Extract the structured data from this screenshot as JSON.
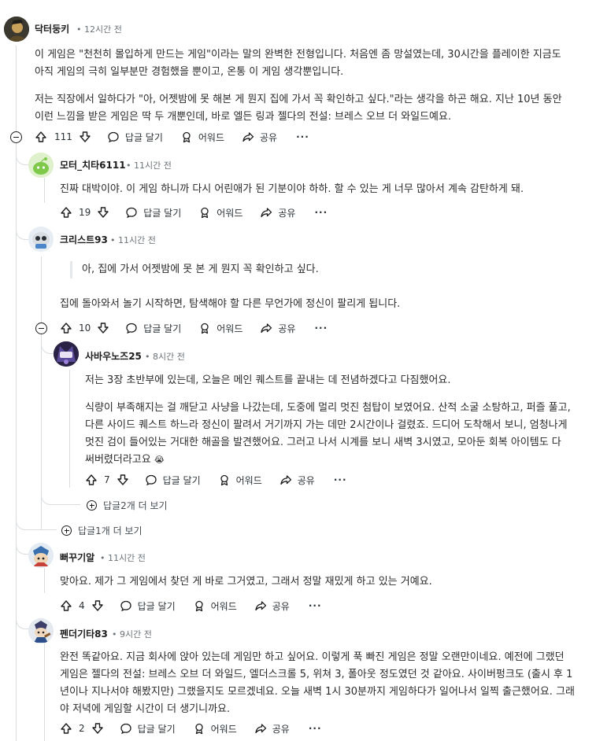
{
  "actions": {
    "reply_label": "답글 달기",
    "award_label": "어워드",
    "share_label": "공유",
    "more_label": "···"
  },
  "comments": [
    {
      "author": "닥터둥키",
      "time": "12시간 전",
      "paragraphs": [
        "이 게임은 \"천천히 몰입하게 만드는 게임\"이라는 말의 완벽한 전형입니다. 처음엔 좀 망설였는데, 30시간을 플레이한 지금도 아직 게임의 극히 일부분만 경험했을 뿐이고, 온통 이 게임 생각뿐입니다.",
        "저는 직장에서 일하다가 \"아, 어젯밤에 못 해본 게 뭔지 집에 가서 꼭 확인하고 싶다.\"라는 생각을 하곤 해요. 지난 10년 동안 이런 느낌을 받은 게임은 딱 두 개뿐인데, 바로 엘든 링과 젤다의 전설: 브레스 오브 더 와일드예요."
      ],
      "votes": "111"
    },
    {
      "author": "모터_치타6111",
      "time": "11시간 전",
      "paragraphs": [
        "진짜 대박이야. 이 게임 하니까 다시 어린애가 된 기분이야 하하. 할 수 있는 게 너무 많아서 계속 감탄하게 돼."
      ],
      "votes": "19"
    },
    {
      "author": "크리스트93",
      "time": "11시간 전",
      "quote": "아, 집에 가서 어젯밤에 못 본 게 뭔지 꼭 확인하고 싶다.",
      "paragraphs": [
        "집에 돌아와서 놀기 시작하면, 탐색해야 할 다른 무언가에 정신이 팔리게 됩니다."
      ],
      "votes": "10"
    },
    {
      "author": "사바우노즈25",
      "time": "8시간 전",
      "paragraphs": [
        "저는 3장 초반부에 있는데, 오늘은 메인 퀘스트를 끝내는 데 전념하겠다고 다짐했어요.",
        "식량이 부족해지는 걸 깨닫고 사냥을 나갔는데, 도중에 멀리 멋진 첨탑이 보였어요. 산적 소굴 소탕하고, 퍼즐 풀고, 다른 사이드 퀘스트 하느라 정신이 팔려서 거기까지 가는 데만 2시간이나 걸렸죠. 드디어 도착해서 보니, 엄청나게 멋진 검이 들어있는 거대한 해골을 발견했어요. 그러고 나서 시계를 보니 새벽 3시였고, 모아둔 회복 아이템도 다 써버렸더라고요"
      ],
      "emoji": "😭",
      "votes": "7"
    },
    {
      "author": "뻐꾸기알",
      "time": "11시간 전",
      "paragraphs": [
        "맞아요. 제가 그 게임에서 찾던 게 바로 그거였고, 그래서 정말 재밌게 하고 있는 거예요."
      ],
      "votes": "4"
    },
    {
      "author": "펜더기타83",
      "time": "9시간 전",
      "paragraphs": [
        "완전 똑같아요. 지금 회사에 앉아 있는데 게임만 하고 싶어요. 이렇게 푹 빠진 게임은 정말 오랜만이네요. 예전에 그랬던 게임은 젤다의 전설: 브레스 오브 더 와일드, 엘더스크롤 5, 위쳐 3, 폴아웃 정도였던 것 같아요. 사이버펑크도 (출시 후 1년이나 지나서야 해봤지만) 그랬을지도 모르겠네요. 오늘 새벽 1시 30분까지 게임하다가 일어나서 일찍 출근했어요. 그래야 저녁에 게임할 시간이 더 생기니까요."
      ],
      "votes": "2"
    }
  ],
  "more_replies": [
    {
      "label": "답글2개 더 보기"
    },
    {
      "label": "답글1개 더 보기"
    }
  ],
  "colors": {
    "text": "#1c1c1c",
    "meta": "#6b7378",
    "thread_line": "#d9dde0"
  }
}
